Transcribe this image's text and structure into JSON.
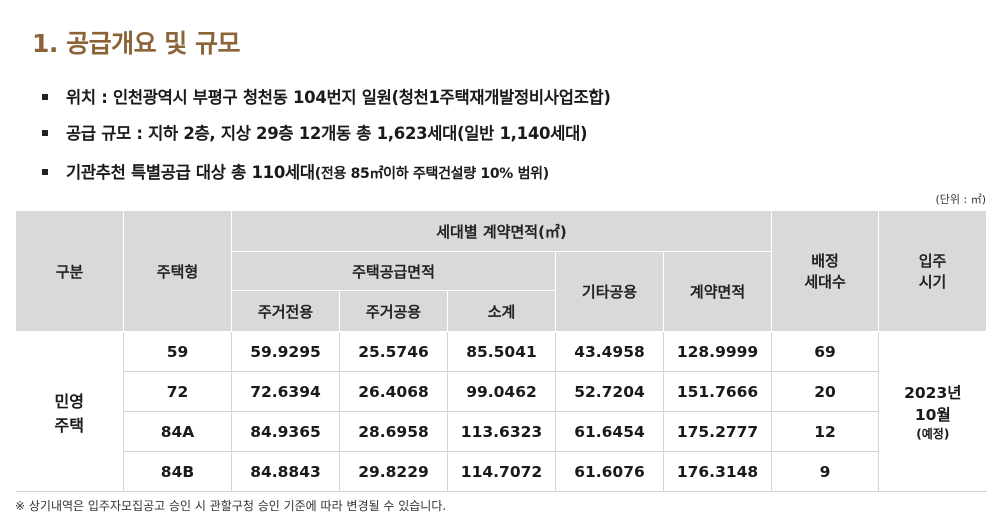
{
  "title": "1. 공급개요 및 규모",
  "bullets": [
    {
      "main": "위치 :  인천광역시 부평구 청천동 104번지 일원(청천1주택재개발정비사업조합)",
      "sub": ""
    },
    {
      "main": "공급 규모 : 지하 2층, 지상 29층 12개동 총 1,623세대(일반 1,140세대)",
      "sub": ""
    },
    {
      "main": "기관추천 특별공급 대상 총 110세대",
      "sub": "(전용 85㎡이하 주택건설량 10% 범위)"
    }
  ],
  "unit_label": "(단위 : ㎡)",
  "table": {
    "headers": {
      "category": "구분",
      "housing_type": "주택형",
      "contract_area_group": "세대별 계약면적(㎡)",
      "supply_area_group": "주택공급면적",
      "exclusive": "주거전용",
      "common": "주거공용",
      "subtotal": "소계",
      "other_common": "기타공용",
      "contract_area": "계약면적",
      "allocated_units": "배정\n세대수",
      "movein": "입주\n시기"
    },
    "category_value": "민영\n주택",
    "rows": [
      {
        "type": "59",
        "exclusive": "59.9295",
        "common": "25.5746",
        "subtotal": "85.5041",
        "other": "43.4958",
        "contract": "128.9999",
        "units": "69"
      },
      {
        "type": "72",
        "exclusive": "72.6394",
        "common": "26.4068",
        "subtotal": "99.0462",
        "other": "52.7204",
        "contract": "151.7666",
        "units": "20"
      },
      {
        "type": "84A",
        "exclusive": "84.9365",
        "common": "28.6958",
        "subtotal": "113.6323",
        "other": "61.6454",
        "contract": "175.2777",
        "units": "12"
      },
      {
        "type": "84B",
        "exclusive": "84.8843",
        "common": "29.8229",
        "subtotal": "114.7072",
        "other": "61.6076",
        "contract": "176.3148",
        "units": "9"
      }
    ],
    "movein_main": "2023년\n10월",
    "movein_note": "(예정)"
  },
  "footnote": "※ 상기내역은 입주자모집공고 승인 시 관할구청 승인 기준에 따라 변경될 수 있습니다."
}
